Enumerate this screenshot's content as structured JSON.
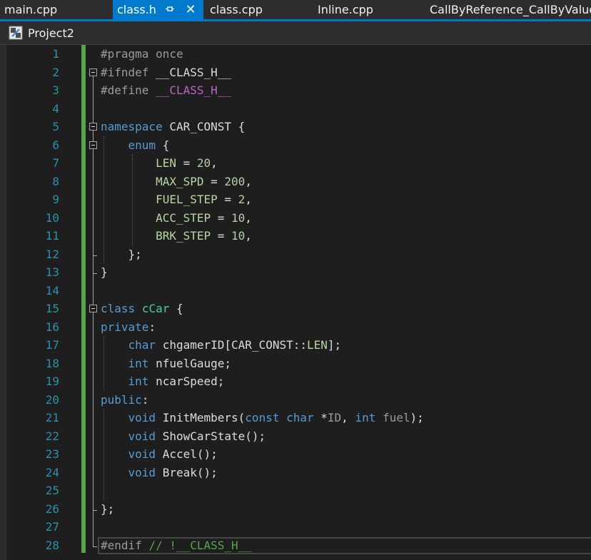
{
  "colors": {
    "accent": "#007acc",
    "keyword": "#569cd6",
    "preprocessor": "#9b9b9b",
    "macro": "#bd63c5",
    "enum_member": "#b8d7a3",
    "class_name": "#4ec9b0",
    "number": "#b5cea8",
    "comment": "#57a64a",
    "parameter": "#9a9a9a",
    "line_number": "#2b91af",
    "change_bar": "#57a64a"
  },
  "tabs": [
    {
      "label": "main.cpp",
      "active": false
    },
    {
      "label": "class.h",
      "active": true,
      "pin_icon": "pin-icon",
      "close_icon": "close-icon"
    },
    {
      "label": "class.cpp",
      "active": false
    },
    {
      "label": "Inline.cpp",
      "active": false
    },
    {
      "label": "CallByReference_CallByValue",
      "active": false
    }
  ],
  "navbar": {
    "project_icon": "project-icon",
    "project_name": "Project2"
  },
  "editor": {
    "current_line": 28,
    "lines": [
      {
        "n": "1",
        "tokens": [
          [
            "pp",
            "#pragma once"
          ]
        ]
      },
      {
        "n": "2",
        "tokens": [
          [
            "pp",
            "#ifndef "
          ],
          [
            "txt",
            "__CLASS_H__"
          ]
        ]
      },
      {
        "n": "3",
        "tokens": [
          [
            "pp",
            "#define "
          ],
          [
            "mac",
            "__CLASS_H__"
          ]
        ]
      },
      {
        "n": "4",
        "tokens": []
      },
      {
        "n": "5",
        "tokens": [
          [
            "kw",
            "namespace"
          ],
          [
            "txt",
            " CAR_CONST {"
          ]
        ]
      },
      {
        "n": "6",
        "tokens": [
          [
            "txt",
            "    "
          ],
          [
            "kw",
            "enum"
          ],
          [
            "txt",
            " {"
          ]
        ]
      },
      {
        "n": "7",
        "tokens": [
          [
            "txt",
            "        "
          ],
          [
            "enm",
            "LEN"
          ],
          [
            "txt",
            " = "
          ],
          [
            "num",
            "20"
          ],
          [
            "txt",
            ","
          ]
        ]
      },
      {
        "n": "8",
        "tokens": [
          [
            "txt",
            "        "
          ],
          [
            "enm",
            "MAX_SPD"
          ],
          [
            "txt",
            " = "
          ],
          [
            "num",
            "200"
          ],
          [
            "txt",
            ","
          ]
        ]
      },
      {
        "n": "9",
        "tokens": [
          [
            "txt",
            "        "
          ],
          [
            "enm",
            "FUEL_STEP"
          ],
          [
            "txt",
            " = "
          ],
          [
            "num",
            "2"
          ],
          [
            "txt",
            ","
          ]
        ]
      },
      {
        "n": "10",
        "tokens": [
          [
            "txt",
            "        "
          ],
          [
            "enm",
            "ACC_STEP"
          ],
          [
            "txt",
            " = "
          ],
          [
            "num",
            "10"
          ],
          [
            "txt",
            ","
          ]
        ]
      },
      {
        "n": "11",
        "tokens": [
          [
            "txt",
            "        "
          ],
          [
            "enm",
            "BRK_STEP"
          ],
          [
            "txt",
            " = "
          ],
          [
            "num",
            "10"
          ],
          [
            "txt",
            ","
          ]
        ]
      },
      {
        "n": "12",
        "tokens": [
          [
            "txt",
            "    };"
          ]
        ]
      },
      {
        "n": "13",
        "tokens": [
          [
            "txt",
            "}"
          ]
        ]
      },
      {
        "n": "14",
        "tokens": []
      },
      {
        "n": "15",
        "tokens": [
          [
            "kw",
            "class"
          ],
          [
            "txt",
            " "
          ],
          [
            "cls",
            "cCar"
          ],
          [
            "txt",
            " {"
          ]
        ]
      },
      {
        "n": "16",
        "tokens": [
          [
            "kw",
            "private"
          ],
          [
            "txt",
            ":"
          ]
        ]
      },
      {
        "n": "17",
        "tokens": [
          [
            "txt",
            "    "
          ],
          [
            "kw",
            "char"
          ],
          [
            "txt",
            " chgamerID[CAR_CONST::"
          ],
          [
            "enm",
            "LEN"
          ],
          [
            "txt",
            "];"
          ]
        ]
      },
      {
        "n": "18",
        "tokens": [
          [
            "txt",
            "    "
          ],
          [
            "kw",
            "int"
          ],
          [
            "txt",
            " nfuelGauge;"
          ]
        ]
      },
      {
        "n": "19",
        "tokens": [
          [
            "txt",
            "    "
          ],
          [
            "kw",
            "int"
          ],
          [
            "txt",
            " ncarSpeed;"
          ]
        ]
      },
      {
        "n": "20",
        "tokens": [
          [
            "kw",
            "public"
          ],
          [
            "txt",
            ":"
          ]
        ]
      },
      {
        "n": "21",
        "tokens": [
          [
            "txt",
            "    "
          ],
          [
            "kw",
            "void"
          ],
          [
            "txt",
            " InitMembers("
          ],
          [
            "kw",
            "const"
          ],
          [
            "txt",
            " "
          ],
          [
            "kw",
            "char"
          ],
          [
            "txt",
            " *"
          ],
          [
            "prm",
            "ID"
          ],
          [
            "txt",
            ", "
          ],
          [
            "kw",
            "int"
          ],
          [
            "txt",
            " "
          ],
          [
            "prm",
            "fuel"
          ],
          [
            "txt",
            ");"
          ]
        ]
      },
      {
        "n": "22",
        "tokens": [
          [
            "txt",
            "    "
          ],
          [
            "kw",
            "void"
          ],
          [
            "txt",
            " ShowCarState();"
          ]
        ]
      },
      {
        "n": "23",
        "tokens": [
          [
            "txt",
            "    "
          ],
          [
            "kw",
            "void"
          ],
          [
            "txt",
            " Accel();"
          ]
        ]
      },
      {
        "n": "24",
        "tokens": [
          [
            "txt",
            "    "
          ],
          [
            "kw",
            "void"
          ],
          [
            "txt",
            " Break();"
          ]
        ]
      },
      {
        "n": "25",
        "tokens": []
      },
      {
        "n": "26",
        "tokens": [
          [
            "txt",
            "};"
          ]
        ]
      },
      {
        "n": "27",
        "tokens": []
      },
      {
        "n": "28",
        "tokens": [
          [
            "pp",
            "#endif "
          ],
          [
            "cmt",
            "// !__CLASS_H__"
          ]
        ]
      }
    ]
  }
}
